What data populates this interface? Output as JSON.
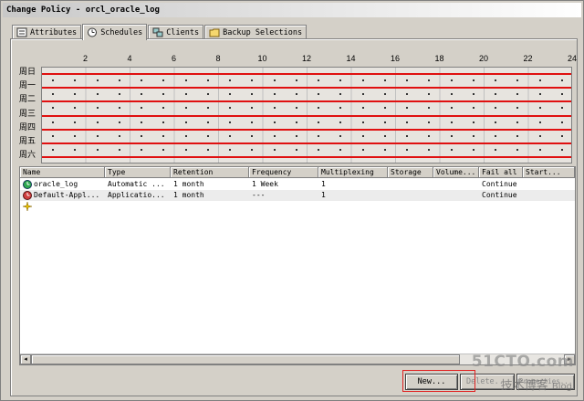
{
  "window": {
    "title": "Change Policy - orcl_oracle_log"
  },
  "tabs": [
    {
      "label": "Attributes",
      "icon": "attributes-icon",
      "active": false
    },
    {
      "label": "Schedules",
      "icon": "schedules-icon",
      "active": true
    },
    {
      "label": "Clients",
      "icon": "clients-icon",
      "active": false
    },
    {
      "label": "Backup Selections",
      "icon": "folder-icon",
      "active": false
    }
  ],
  "schedule_grid": {
    "hours": [
      "2",
      "4",
      "6",
      "8",
      "10",
      "12",
      "14",
      "16",
      "18",
      "20",
      "22",
      "24"
    ],
    "days": [
      "周日",
      "周一",
      "周二",
      "周三",
      "周四",
      "周五",
      "周六"
    ],
    "window_color": "#e01010"
  },
  "table": {
    "columns": [
      "Name",
      "Type",
      "Retention",
      "Frequency",
      "Multiplexing",
      "Storage",
      "Volume...",
      "Fail all",
      "Start..."
    ],
    "rows": [
      {
        "icon": "schedule-green-icon",
        "cells": [
          "oracle_log",
          "Automatic ...",
          "1 month",
          "1 Week",
          "1",
          "",
          "",
          "Continue",
          ""
        ]
      },
      {
        "icon": "schedule-red-icon",
        "cells": [
          "Default-Appl...",
          "Applicatio...",
          "1 month",
          "---",
          "1",
          "",
          "",
          "Continue",
          ""
        ]
      }
    ],
    "new_row_icon": "new-item-sparkle-icon"
  },
  "buttons": {
    "new": "New...",
    "delete": "Delete...",
    "properties": "Properties..."
  },
  "watermark": {
    "site": "51CTO.com",
    "tagline": "技术博客",
    "blog": "Blog"
  }
}
